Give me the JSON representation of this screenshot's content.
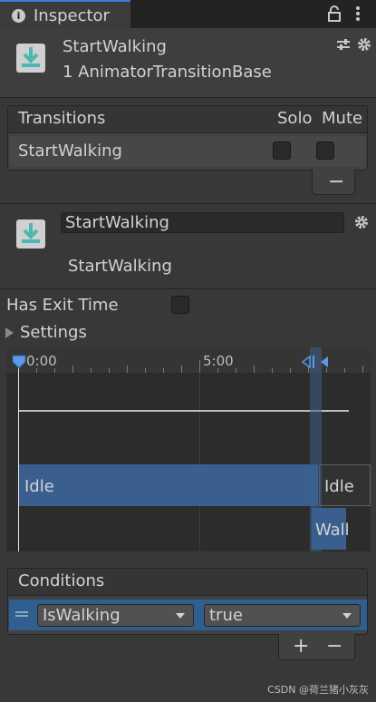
{
  "window": {
    "tab_title": "Inspector",
    "tab_icon": "info-icon",
    "icons": [
      "lock-icon",
      "kebab-menu-icon"
    ]
  },
  "header": {
    "title": "StartWalking",
    "subtitle": "1 AnimatorTransitionBase",
    "icons": [
      "animator-transition-icon",
      "preset-icon",
      "gear-icon"
    ]
  },
  "transitions": {
    "header_label": "Transitions",
    "solo_label": "Solo",
    "mute_label": "Mute",
    "rows": [
      {
        "name": "StartWalking",
        "solo": false,
        "mute": false
      }
    ],
    "remove_label": "−"
  },
  "transition": {
    "name_value": "StartWalking",
    "subtitle": "StartWalking",
    "has_exit_time_label": "Has Exit Time",
    "has_exit_time": false,
    "settings_label": "Settings"
  },
  "timeline": {
    "ruler_labels": [
      "0:00",
      "5:00"
    ],
    "from_state": "Idle",
    "to_state_top": "Idle",
    "to_state_bottom": "Walk"
  },
  "conditions": {
    "header_label": "Conditions",
    "rows": [
      {
        "parameter": "IsWalking",
        "value": "true"
      }
    ],
    "add_label": "+",
    "remove_label": "−"
  },
  "colors": {
    "panel": "#383838",
    "selection": "#2f5f90",
    "state_bar": "#3a5f8f"
  },
  "watermark": "CSDN @荷兰猪小灰灰"
}
